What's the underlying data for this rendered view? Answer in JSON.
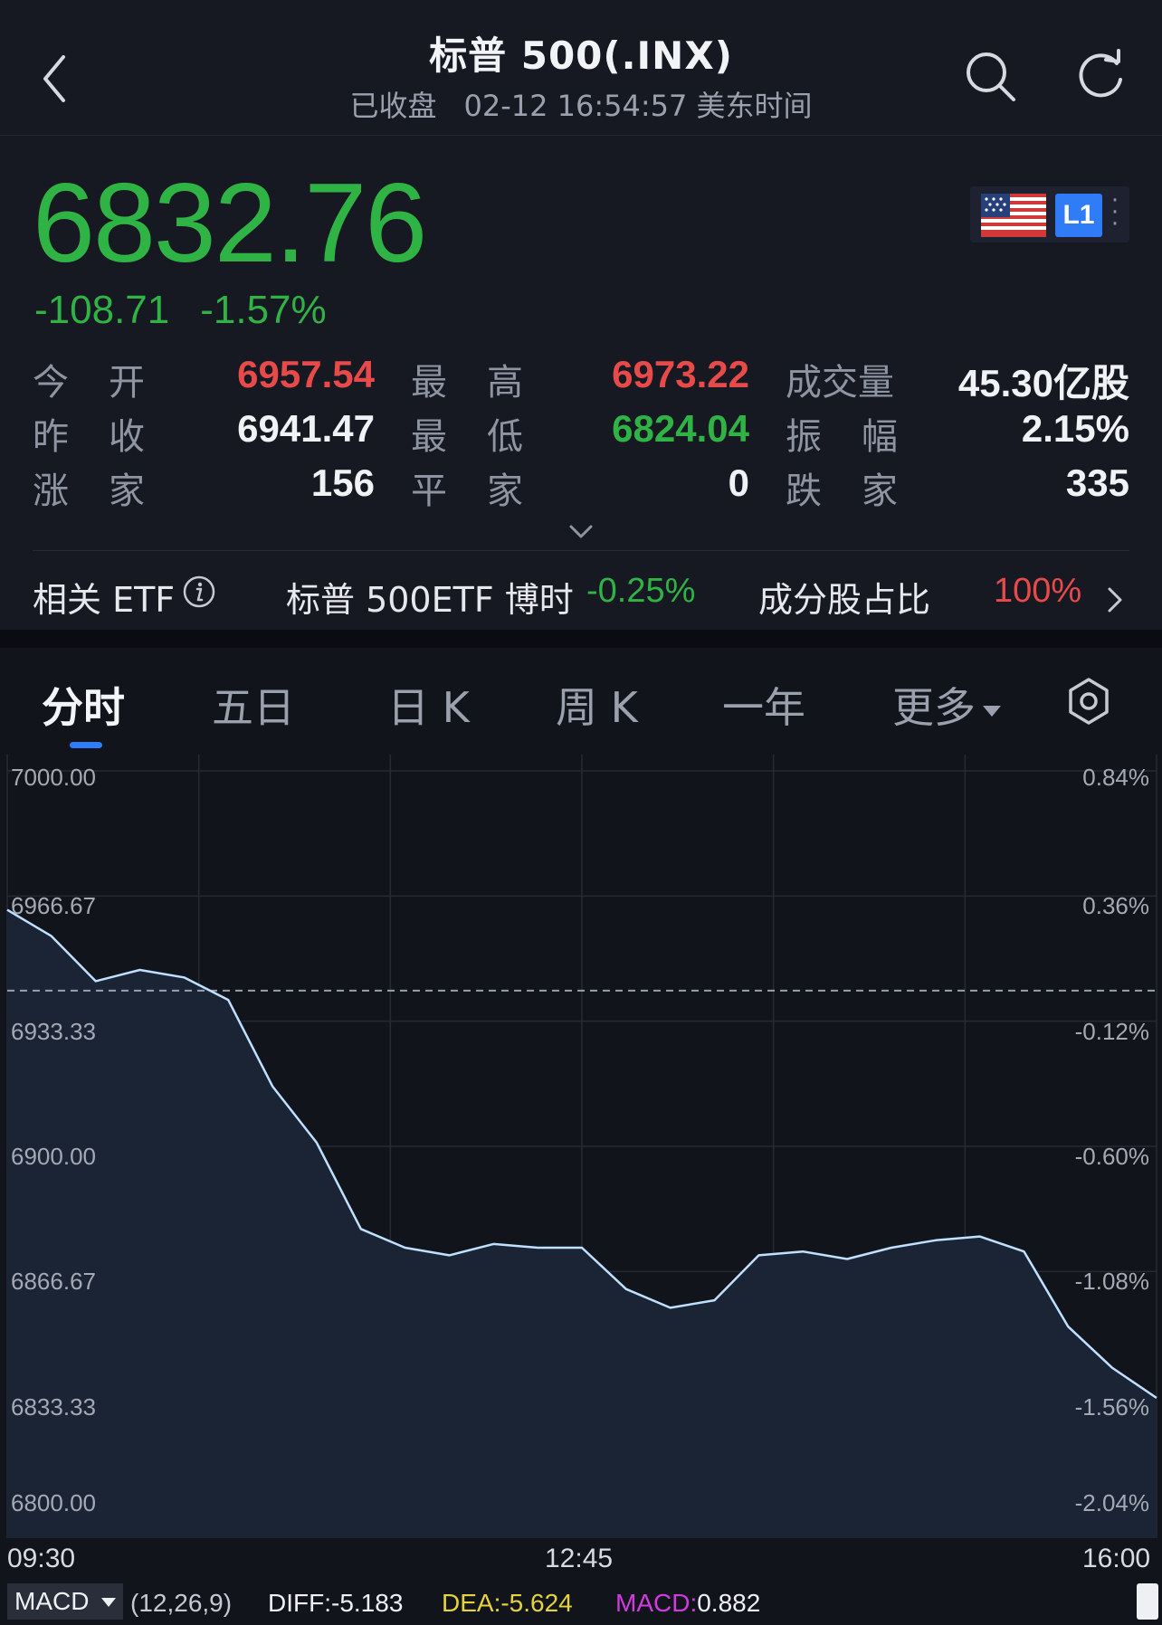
{
  "header": {
    "title": "标普 500(.INX)",
    "status": "已收盘",
    "datetime": "02-12 16:54:57 美东时间"
  },
  "icons": {
    "back": "chevron-left-icon",
    "search": "search-icon",
    "refresh": "refresh-icon",
    "market_flag": "us-flag-icon",
    "info": "info-icon",
    "settings": "settings-icon"
  },
  "quote": {
    "price": "6832.76",
    "change": "-108.71",
    "change_pct": "-1.57%",
    "level_badge": "L1",
    "colors": {
      "up": "#e84a4a",
      "down": "#2fb344",
      "accent": "#2f7cf6"
    }
  },
  "stats": {
    "open_label": "今开",
    "open_value": "6957.54",
    "high_label": "最高",
    "high_value": "6973.22",
    "volume_label": "成交量",
    "volume_value": "45.30亿股",
    "prev_close_label": "昨收",
    "prev_close_value": "6941.47",
    "low_label": "最低",
    "low_value": "6824.04",
    "amplitude_label": "振幅",
    "amplitude_value": "2.15%",
    "advancers_label": "涨家",
    "advancers_value": "156",
    "unchanged_label": "平家",
    "unchanged_value": "0",
    "decliners_label": "跌家",
    "decliners_value": "335"
  },
  "etf": {
    "label": "相关 ETF",
    "name": "标普 500ETF 博时",
    "change": "-0.25%",
    "component_label": "成分股占比",
    "component_value": "100%"
  },
  "tabs": [
    {
      "label": "分时",
      "active": true
    },
    {
      "label": "五日",
      "active": false
    },
    {
      "label": "日 K",
      "active": false
    },
    {
      "label": "周 K",
      "active": false
    },
    {
      "label": "一年",
      "active": false
    },
    {
      "label": "更多",
      "active": false
    }
  ],
  "chart_data": {
    "type": "line",
    "ylabels_left": [
      "7000.00",
      "6966.67",
      "6933.33",
      "6900.00",
      "6866.67",
      "6833.33",
      "6800.00"
    ],
    "ylabels_right": [
      "0.84%",
      "0.36%",
      "-0.12%",
      "-0.60%",
      "-1.08%",
      "-1.56%",
      "-2.04%"
    ],
    "ylim": [
      6800,
      7000
    ],
    "prev_close": 6941.47,
    "x_labels": [
      "09:30",
      "12:45",
      "16:00"
    ],
    "x": [
      "09:30",
      "09:45",
      "10:00",
      "10:15",
      "10:30",
      "10:45",
      "11:00",
      "11:15",
      "11:30",
      "11:45",
      "12:00",
      "12:15",
      "12:30",
      "12:45",
      "13:00",
      "13:15",
      "13:30",
      "13:45",
      "14:00",
      "14:15",
      "14:30",
      "14:45",
      "15:00",
      "15:15",
      "15:30",
      "15:45",
      "16:00"
    ],
    "values": [
      6963,
      6956,
      6944,
      6947,
      6945,
      6939,
      6916,
      6901,
      6878,
      6873,
      6871,
      6874,
      6873,
      6873,
      6862,
      6857,
      6859,
      6871,
      6872,
      6870,
      6873,
      6875,
      6876,
      6872,
      6852,
      6841,
      6833
    ],
    "grid": true
  },
  "time_axis": {
    "start": "09:30",
    "mid": "12:45",
    "end": "16:00"
  },
  "macd": {
    "selector": "MACD",
    "params": "(12,26,9)",
    "diff_label": "DIFF:",
    "diff_value": "-5.183",
    "dea_label": "DEA:",
    "dea_value": "-5.624",
    "macd_label": "MACD:",
    "macd_value": "0.882",
    "colors": {
      "diff": "#eef0f4",
      "dea": "#e6d23a",
      "macd": "#d13adf"
    }
  }
}
